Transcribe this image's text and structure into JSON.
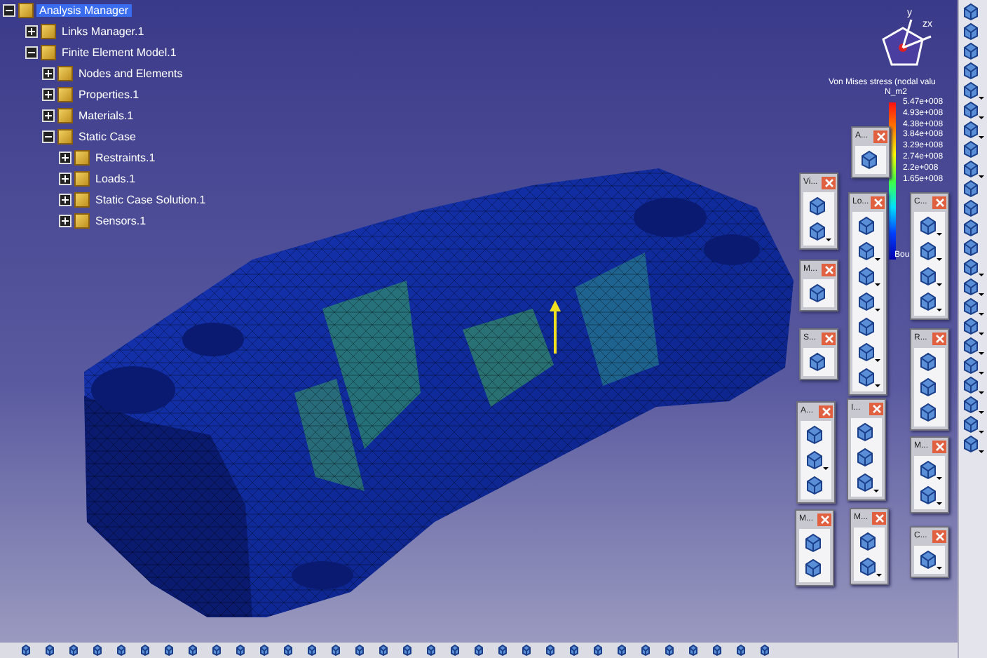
{
  "tree": {
    "label": "Analysis Manager",
    "selected": true,
    "expanded": true,
    "children": [
      {
        "label": "Links Manager.1",
        "selected": false,
        "expanded": false
      },
      {
        "label": "Finite Element Model.1",
        "selected": false,
        "expanded": true,
        "children": [
          {
            "label": "Nodes and Elements",
            "selected": false,
            "expanded": false
          },
          {
            "label": "Properties.1",
            "selected": false,
            "expanded": false
          },
          {
            "label": "Materials.1",
            "selected": false,
            "expanded": false
          },
          {
            "label": "Static Case",
            "selected": false,
            "expanded": true,
            "children": [
              {
                "label": "Restraints.1",
                "selected": false,
                "expanded": false
              },
              {
                "label": "Loads.1",
                "selected": false,
                "expanded": false
              },
              {
                "label": "Static Case Solution.1",
                "selected": false,
                "expanded": false
              },
              {
                "label": "Sensors.1",
                "selected": false,
                "expanded": false
              }
            ]
          }
        ]
      }
    ]
  },
  "compass": {
    "labels": [
      "y",
      "zx"
    ]
  },
  "legend": {
    "title": "Von Mises stress (nodal valu",
    "unit": "N_m2",
    "values": [
      "5.47e+008",
      "4.93e+008",
      "4.38e+008",
      "3.84e+008",
      "3.29e+008",
      "2.74e+008",
      "2.2e+008",
      "1.65e+008"
    ],
    "footer": "Bou"
  },
  "toolbars": [
    {
      "title": "A...",
      "tools": [
        {
          "has_menu": false
        }
      ]
    },
    {
      "title": "Vi...",
      "tools": [
        {
          "has_menu": false
        },
        {
          "has_menu": true
        }
      ]
    },
    {
      "title": "Lo...",
      "tools": [
        {
          "has_menu": false
        },
        {
          "has_menu": true
        },
        {
          "has_menu": true
        },
        {
          "has_menu": true
        },
        {
          "has_menu": false
        },
        {
          "has_menu": true
        },
        {
          "has_menu": true
        }
      ]
    },
    {
      "title": "C...",
      "tools": [
        {
          "has_menu": true
        },
        {
          "has_menu": true
        },
        {
          "has_menu": true
        },
        {
          "has_menu": true
        }
      ]
    },
    {
      "title": "M...",
      "tools": [
        {
          "has_menu": false
        }
      ]
    },
    {
      "title": "S...",
      "tools": [
        {
          "has_menu": false
        }
      ]
    },
    {
      "title": "R...",
      "tools": [
        {
          "has_menu": false
        },
        {
          "has_menu": false
        },
        {
          "has_menu": false
        }
      ]
    },
    {
      "title": "A...",
      "tools": [
        {
          "has_menu": false
        },
        {
          "has_menu": true
        },
        {
          "has_menu": false
        }
      ]
    },
    {
      "title": "I...",
      "tools": [
        {
          "has_menu": false
        },
        {
          "has_menu": false
        },
        {
          "has_menu": true
        }
      ]
    },
    {
      "title": "M...",
      "tools": [
        {
          "has_menu": true
        },
        {
          "has_menu": true
        }
      ]
    },
    {
      "title": "M...",
      "tools": [
        {
          "has_menu": false
        },
        {
          "has_menu": false
        }
      ]
    },
    {
      "title": "M...",
      "tools": [
        {
          "has_menu": false
        },
        {
          "has_menu": true
        }
      ]
    },
    {
      "title": "C...",
      "tools": [
        {
          "has_menu": true
        }
      ]
    }
  ],
  "right_toolbar": {
    "tools": [
      {
        "has_menu": false
      },
      {
        "has_menu": false
      },
      {
        "has_menu": false
      },
      {
        "has_menu": false
      },
      {
        "has_menu": true
      },
      {
        "has_menu": true
      },
      {
        "has_menu": true
      },
      {
        "has_menu": false
      },
      {
        "has_menu": true
      },
      {
        "has_menu": false
      },
      {
        "has_menu": false
      },
      {
        "has_menu": false
      },
      {
        "has_menu": false
      },
      {
        "has_menu": true
      },
      {
        "has_menu": true
      },
      {
        "has_menu": true
      },
      {
        "has_menu": true
      },
      {
        "has_menu": true
      },
      {
        "has_menu": true
      },
      {
        "has_menu": true
      },
      {
        "has_menu": true
      },
      {
        "has_menu": true
      },
      {
        "has_menu": true
      }
    ]
  },
  "bottom_toolbar": {
    "tools": [
      {
        "has_menu": false
      },
      {
        "has_menu": false
      },
      {
        "has_menu": false
      },
      {
        "has_menu": false
      },
      {
        "has_menu": false
      },
      {
        "has_menu": false
      },
      {
        "has_menu": false
      },
      {
        "has_menu": false
      },
      {
        "has_menu": false
      },
      {
        "has_menu": false
      },
      {
        "has_menu": false
      },
      {
        "has_menu": false
      },
      {
        "has_menu": false
      },
      {
        "has_menu": false
      },
      {
        "has_menu": false
      },
      {
        "has_menu": false
      },
      {
        "has_menu": false
      },
      {
        "has_menu": false
      },
      {
        "has_menu": false
      },
      {
        "has_menu": false
      },
      {
        "has_menu": false
      },
      {
        "has_menu": false
      },
      {
        "has_menu": false
      },
      {
        "has_menu": false
      },
      {
        "has_menu": false
      },
      {
        "has_menu": false
      },
      {
        "has_menu": false
      },
      {
        "has_menu": false
      },
      {
        "has_menu": false
      },
      {
        "has_menu": false
      },
      {
        "has_menu": false
      },
      {
        "has_menu": false
      }
    ]
  }
}
